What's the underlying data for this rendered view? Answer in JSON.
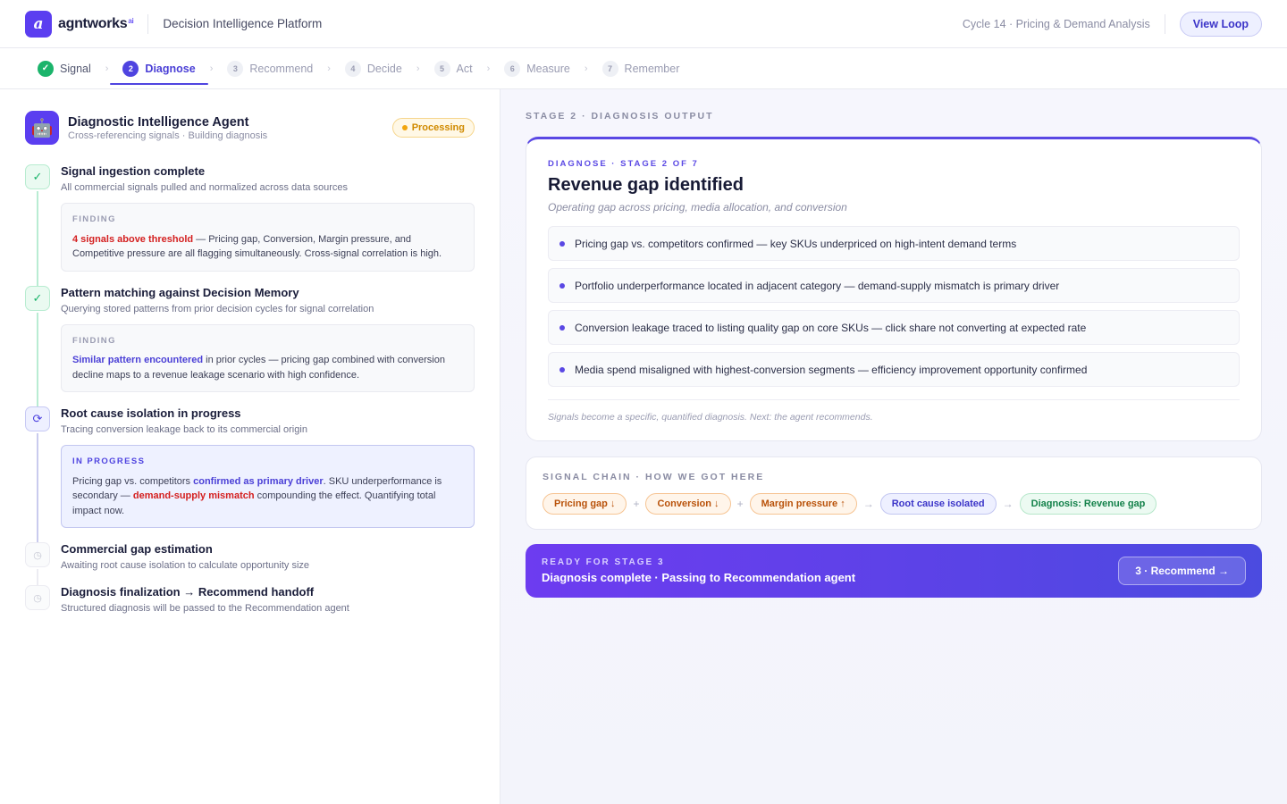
{
  "header": {
    "logo_letter": "a",
    "brand": "agntworks",
    "brand_sup": "ai",
    "platform": "Decision Intelligence Platform",
    "cycle": "Cycle 14 · Pricing & Demand Analysis",
    "view_loop": "View Loop"
  },
  "stepper": {
    "steps": [
      {
        "num": "✓",
        "label": "Signal",
        "state": "done"
      },
      {
        "num": "2",
        "label": "Diagnose",
        "state": "active"
      },
      {
        "num": "3",
        "label": "Recommend",
        "state": "pending"
      },
      {
        "num": "4",
        "label": "Decide",
        "state": "pending"
      },
      {
        "num": "5",
        "label": "Act",
        "state": "pending"
      },
      {
        "num": "6",
        "label": "Measure",
        "state": "pending"
      },
      {
        "num": "7",
        "label": "Remember",
        "state": "pending"
      }
    ],
    "separator": "›"
  },
  "agent": {
    "title": "Diagnostic Intelligence Agent",
    "subtitle": "Cross-referencing signals · Building diagnosis",
    "status": "Processing"
  },
  "timeline": [
    {
      "title": "Signal ingestion complete",
      "sub": "All commercial signals pulled and normalized across data sources",
      "finding_label": "FINDING",
      "finding_hl": "4 signals above threshold",
      "finding_rest": " — Pricing gap, Conversion, Margin pressure, and Competitive pressure are all flagging simultaneously. Cross-signal correlation is high."
    },
    {
      "title": "Pattern matching against Decision Memory",
      "sub": "Querying stored patterns from prior decision cycles for signal correlation",
      "finding_label": "FINDING",
      "finding_hl": "Similar pattern encountered",
      "finding_rest": " in prior cycles — pricing gap combined with conversion decline maps to a revenue leakage scenario with high confidence."
    },
    {
      "title": "Root cause isolation in progress",
      "sub": "Tracing conversion leakage back to its commercial origin",
      "finding_label": "IN PROGRESS",
      "p1": "Pricing gap vs. competitors ",
      "hl1": "confirmed as primary driver",
      "p2": ". SKU underperformance is secondary — ",
      "hl2": "demand-supply mismatch",
      "p3": " compounding the effect. Quantifying total impact now."
    },
    {
      "title": "Commercial gap estimation",
      "sub": "Awaiting root cause isolation to calculate opportunity size"
    },
    {
      "title": "Diagnosis finalization → Recommend handoff",
      "sub": "Structured diagnosis will be passed to the Recommendation agent"
    }
  ],
  "right": {
    "stage_label": "STAGE 2 · DIAGNOSIS OUTPUT",
    "diag": {
      "kicker": "DIAGNOSE · STAGE 2 OF 7",
      "title": "Revenue gap identified",
      "subtitle": "Operating gap across pricing, media allocation, and conversion",
      "items": [
        "Pricing gap vs. competitors confirmed — key SKUs underpriced on high-intent demand terms",
        "Portfolio underperformance located in adjacent category — demand-supply mismatch is primary driver",
        "Conversion leakage traced to listing quality gap on core SKUs — click share not converting at expected rate",
        "Media spend misaligned with highest-conversion segments — efficiency improvement opportunity confirmed"
      ],
      "footer": "Signals become a specific, quantified diagnosis. Next: the agent recommends."
    },
    "chain": {
      "label": "SIGNAL CHAIN · HOW WE GOT HERE",
      "chips": [
        "Pricing gap ↓",
        "Conversion ↓",
        "Margin pressure ↑",
        "Root cause isolated",
        "Diagnosis: Revenue gap"
      ],
      "seps": [
        "+",
        "+",
        "→",
        "→"
      ]
    },
    "ready": {
      "kicker": "READY FOR STAGE 3",
      "title": "Diagnosis complete · Passing to Recommendation agent",
      "button": "3 · Recommend →"
    }
  },
  "colors": {
    "accent": "#5b3ef0",
    "success": "#1bb46b",
    "warning": "#f2a50c",
    "danger": "#d42020"
  }
}
